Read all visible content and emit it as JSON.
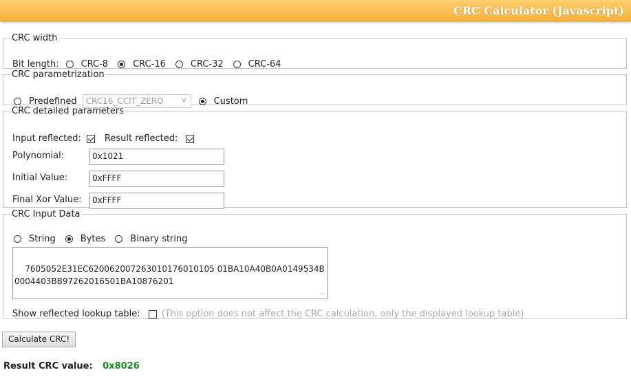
{
  "header": {
    "title": "CRC Calculator (Javascript)"
  },
  "width_section": {
    "legend": "CRC width",
    "label": "Bit length:",
    "options": [
      "CRC-8",
      "CRC-16",
      "CRC-32",
      "CRC-64"
    ],
    "selected": "CRC-16"
  },
  "param_section": {
    "legend": "CRC parametrization",
    "predefined_label": "Predefined",
    "predefined_value": "CRC16_CCIT_ZERO",
    "custom_label": "Custom",
    "selected": "Custom"
  },
  "detail_section": {
    "legend": "CRC detailed parameters",
    "input_reflected_label": "Input reflected:",
    "input_reflected": true,
    "result_reflected_label": "Result reflected:",
    "result_reflected": true,
    "polynomial_label": "Polynomial:",
    "polynomial": "0x1021",
    "initial_label": "Initial Value:",
    "initial": "0xFFFF",
    "final_xor_label": "Final Xor Value:",
    "final_xor": "0xFFFF"
  },
  "input_section": {
    "legend": "CRC Input Data",
    "string_label": "String",
    "bytes_label": "Bytes",
    "binary_label": "Binary string",
    "selected": "Bytes",
    "data": "7605052E31EC620062007263010176010105 01BA10A40B0A0149534B\n0004403BB97262016501BA10876201",
    "lookup_label": "Show reflected lookup table:",
    "lookup_note": "(This option does not affect the CRC calculation, only the displayed lookup table)"
  },
  "calc_button": "Calculate CRC!",
  "result": {
    "label": "Result CRC value:",
    "value": "0x8026"
  }
}
